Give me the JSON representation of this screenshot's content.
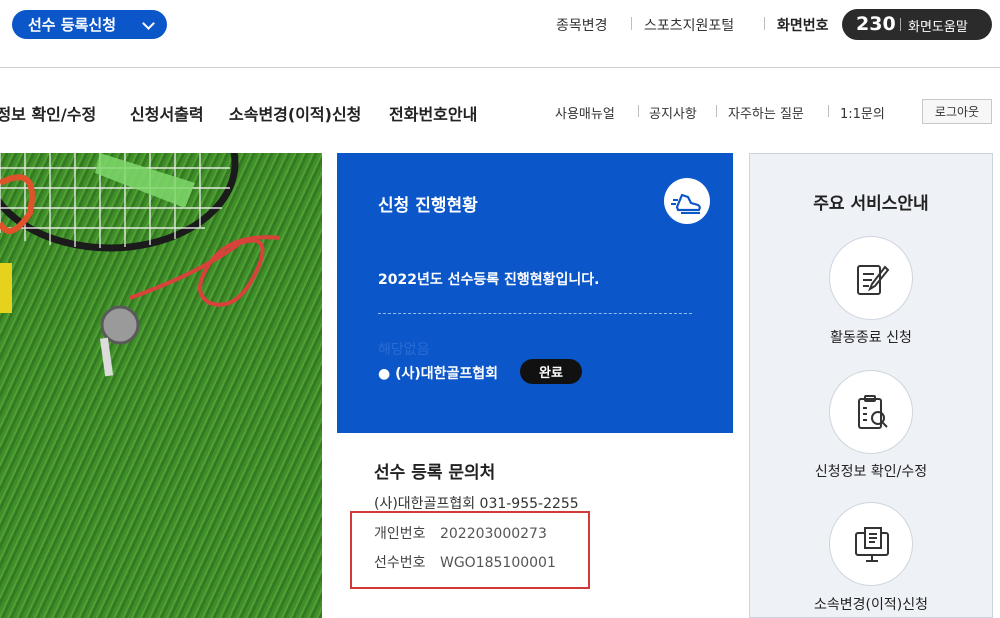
{
  "header": {
    "registration_menu": "선수 등록신청",
    "links": [
      "종목변경",
      "스포츠지원포털"
    ],
    "screen_number_label": "화면번호",
    "screen_number": "230",
    "screen_help": "화면도움말"
  },
  "nav": {
    "items": [
      "신청정보 확인/수정",
      "신청서출력",
      "소속변경(이적)신청",
      "전화번호안내"
    ],
    "sub_links": [
      "사용매뉴얼",
      "공지사항",
      "자주하는 질문",
      "1:1문의"
    ],
    "logout": "로그아웃"
  },
  "status": {
    "title": "신청 진행현황",
    "description": "2022년도 선수등록 진행현황입니다.",
    "empty_text": "해당없음",
    "organization": "● (사)대한골프협회",
    "badge": "완료",
    "icon": "running-shoe-icon"
  },
  "contact": {
    "title": "선수 등록 문의처",
    "org_phone": "(사)대한골프협회  031-955-2255",
    "personal_no_label": "개인번호",
    "personal_no_value": "202203000273",
    "player_no_label": "선수번호",
    "player_no_value": "WGO185100001"
  },
  "services": {
    "title": "주요 서비스안내",
    "items": [
      {
        "label": "활동종료 신청",
        "icon": "write-form-icon"
      },
      {
        "label": "신청정보 확인/수정",
        "icon": "document-search-icon"
      },
      {
        "label": "소속변경(이적)신청",
        "icon": "monitor-document-icon"
      }
    ]
  },
  "colors": {
    "primary_blue": "#0b56c9",
    "dark_pill": "#2b2b2b",
    "highlight_red": "#d23a3a"
  }
}
